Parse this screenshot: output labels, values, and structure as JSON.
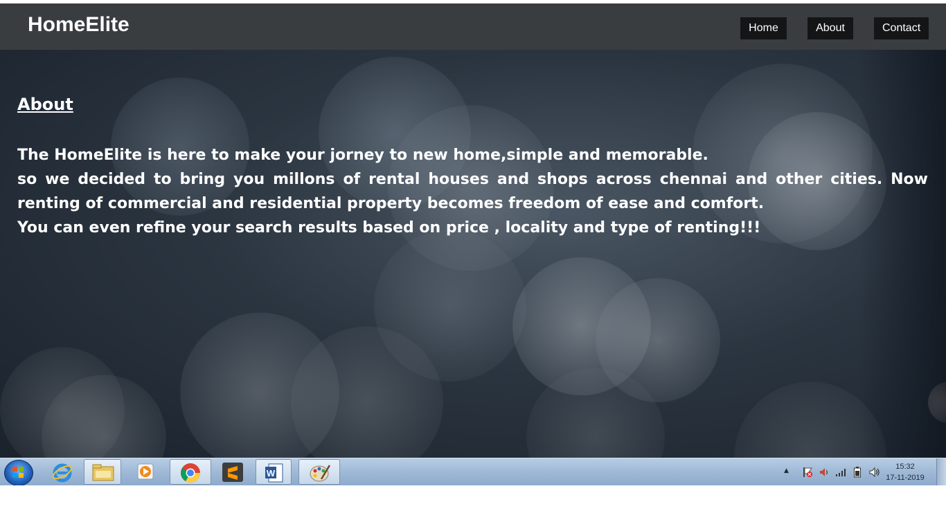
{
  "navbar": {
    "brand": "HomeElite",
    "links": [
      {
        "label": "Home"
      },
      {
        "label": "About"
      },
      {
        "label": "Contact"
      }
    ]
  },
  "about": {
    "heading": "About",
    "paragraphs": [
      "The HomeElite is here to make your jorney to new home,simple and memorable.",
      "so we decided to bring you millons of rental houses and shops across chennai and other cities. Now renting of commercial and residential property becomes freedom of ease and comfort.",
      "You can even refine your search results based on price , locality and type of renting!!!"
    ]
  },
  "taskbar": {
    "apps": [
      {
        "icon": "internet-explorer-icon"
      },
      {
        "icon": "file-explorer-icon"
      },
      {
        "icon": "media-player-icon"
      },
      {
        "icon": "chrome-icon"
      },
      {
        "icon": "sublime-text-icon"
      },
      {
        "icon": "word-icon"
      },
      {
        "icon": "paint-icon"
      }
    ],
    "tray_icons": [
      "show-hidden-icons-icon",
      "action-center-icon",
      "volume-icon",
      "network-icon",
      "battery-icon",
      "speaker-icon"
    ],
    "clock": {
      "time": "15:32",
      "date": "17-11-2019"
    }
  },
  "colors": {
    "navbar_bg": "#3a3d40",
    "nav_button_bg": "#141516",
    "text": "#ffffff"
  }
}
